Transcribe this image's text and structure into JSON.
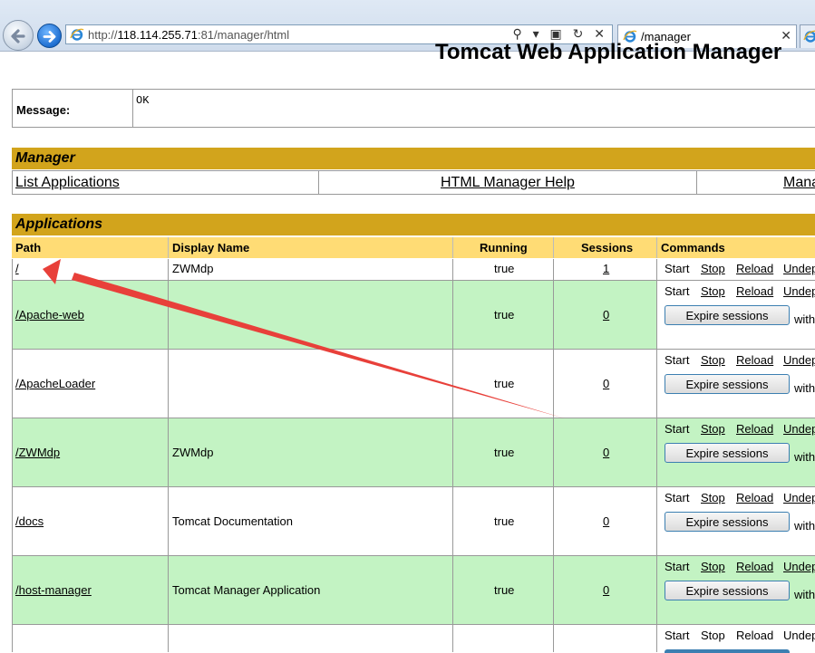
{
  "browser": {
    "url_prefix": "http://",
    "url_host": "118.114.255.71",
    "url_rest": ":81/manager/html",
    "tab_title": "/manager",
    "tab_close": "✕",
    "address_tools": "⚲ ▾ ▣ ↻ ✕"
  },
  "page": {
    "title": "Tomcat Web Application Manager",
    "message_label": "Message:",
    "message_value": "OK"
  },
  "manager": {
    "header": "Manager",
    "links": [
      "List Applications",
      "HTML Manager Help",
      "Mana"
    ]
  },
  "applications": {
    "header": "Applications",
    "columns": [
      "Path",
      "Display Name",
      "Running",
      "Sessions",
      "Commands"
    ],
    "commands": {
      "start": "Start",
      "stop": "Stop",
      "reload": "Reload",
      "undeploy": "Undep",
      "expire": "Expire sessions",
      "with": "with"
    },
    "rows": [
      {
        "path": "/",
        "display": "ZWMdp",
        "running": "true",
        "sessions": "1"
      },
      {
        "path": "/Apache-web",
        "display": "",
        "running": "true",
        "sessions": "0"
      },
      {
        "path": "/ApacheLoader",
        "display": "",
        "running": "true",
        "sessions": "0"
      },
      {
        "path": "/ZWMdp",
        "display": "ZWMdp",
        "running": "true",
        "sessions": "0"
      },
      {
        "path": "/docs",
        "display": "Tomcat Documentation",
        "running": "true",
        "sessions": "0"
      },
      {
        "path": "/host-manager",
        "display": "Tomcat Manager Application",
        "running": "true",
        "sessions": "0"
      },
      {
        "path": "",
        "display": "",
        "running": "",
        "sessions": ""
      }
    ]
  },
  "colors": {
    "section_header": "#d2a41c",
    "column_header": "#ffdc75",
    "row_green": "#c3f3c3",
    "annotation_arrow": "#e8403a"
  }
}
